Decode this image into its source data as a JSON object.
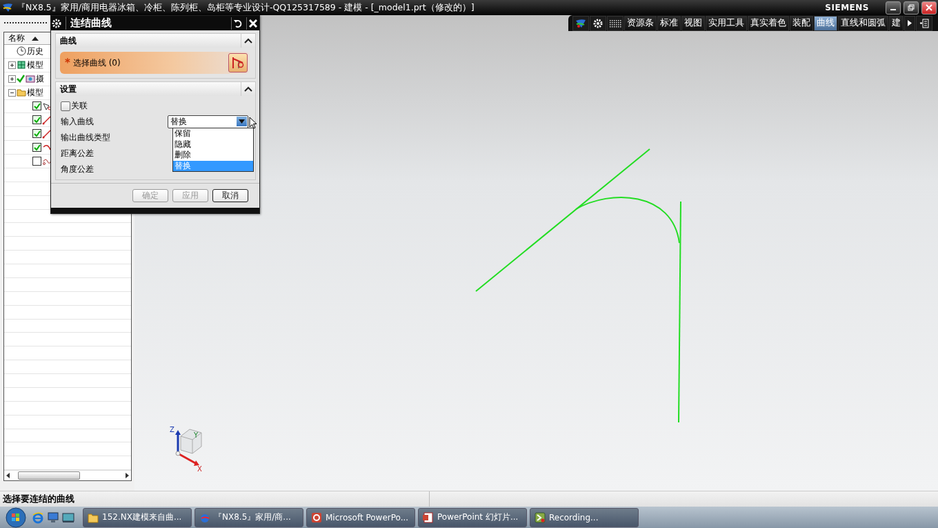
{
  "window": {
    "title": "『NX8.5』家用/商用电器冰箱、冷柜、陈列柜、岛柜等专业设计-QQ125317589 - 建模 - [_model1.prt（修改的）]",
    "brand": "SIEMENS"
  },
  "toolbar": {
    "tabs": [
      {
        "label": "资源条",
        "selected": false
      },
      {
        "label": "标准",
        "selected": false
      },
      {
        "label": "视图",
        "selected": false
      },
      {
        "label": "实用工具",
        "selected": false
      },
      {
        "label": "真实着色",
        "selected": false
      },
      {
        "label": "装配",
        "selected": false
      },
      {
        "label": "曲线",
        "selected": true
      },
      {
        "label": "直线和圆弧",
        "selected": false
      },
      {
        "label": "建",
        "selected": false
      }
    ]
  },
  "navigator": {
    "column": "名称",
    "items": [
      {
        "label": "历史",
        "kind": "history"
      },
      {
        "label": "模型",
        "kind": "views",
        "expanded": false
      },
      {
        "label": "摄",
        "kind": "camera",
        "expanded": false
      },
      {
        "label": "模型",
        "kind": "folder",
        "expanded": true,
        "children": [
          {
            "checked": true,
            "kind": "sketch"
          },
          {
            "checked": true,
            "kind": "line"
          },
          {
            "checked": true,
            "kind": "line"
          },
          {
            "checked": true,
            "kind": "arc"
          },
          {
            "checked": false,
            "kind": "join"
          }
        ]
      }
    ]
  },
  "dialog": {
    "title": "连结曲线",
    "sections": [
      {
        "title": "曲线",
        "expanded": true,
        "kind": "selection",
        "required_mark": "*",
        "label": "选择曲线 (0)"
      },
      {
        "title": "设置",
        "expanded": true,
        "kind": "settings",
        "checkbox": {
          "label": "关联",
          "checked": false
        },
        "fields": [
          {
            "label": "输入曲线",
            "value": "替换",
            "open": true,
            "options": [
              {
                "label": "保留",
                "selected": false
              },
              {
                "label": "隐藏",
                "selected": false
              },
              {
                "label": "删除",
                "selected": false
              },
              {
                "label": "替换",
                "selected": true
              }
            ]
          },
          {
            "label": "输出曲线类型"
          },
          {
            "label": "距离公差"
          },
          {
            "label": "角度公差"
          }
        ]
      }
    ],
    "buttons": [
      {
        "label": "确定",
        "disabled": true
      },
      {
        "label": "应用",
        "disabled": true
      },
      {
        "label": "取消",
        "disabled": false
      }
    ]
  },
  "viewport": {
    "axes": [
      "Z",
      "Y",
      "X"
    ]
  },
  "status_bar": {
    "prompt": "选择要连结的曲线"
  },
  "taskbar": {
    "items": [
      {
        "label": "152.NX建模来自曲...",
        "kind": "folder"
      },
      {
        "label": "『NX8.5』家用/商...",
        "kind": "nx"
      },
      {
        "label": "Microsoft PowerPo...",
        "kind": "powerpoint"
      },
      {
        "label": "PowerPoint 幻灯片...",
        "kind": "slides"
      },
      {
        "label": "Recording...",
        "kind": "recorder"
      }
    ]
  }
}
